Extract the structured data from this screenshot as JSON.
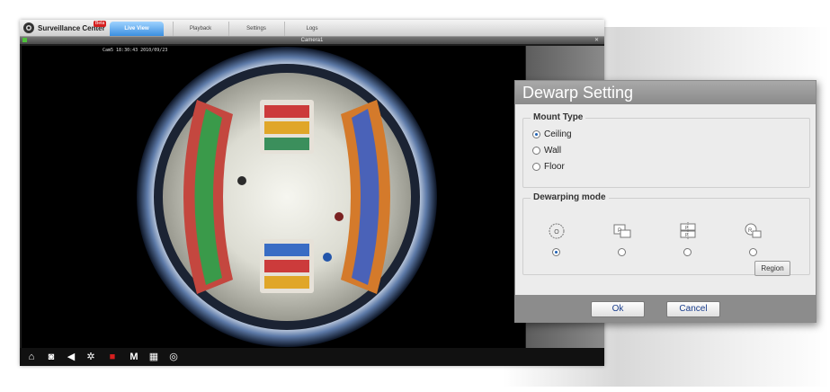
{
  "app": {
    "title": "Surveillance Center",
    "badge": "Beta",
    "tabs": [
      {
        "label": "Live View",
        "active": true
      },
      {
        "label": "Playback",
        "active": false
      },
      {
        "label": "Settings",
        "active": false
      },
      {
        "label": "Logs",
        "active": false
      }
    ]
  },
  "camera_window": {
    "title": "Camera1",
    "osd_text": "Cam5 18:30:43 2010/09/23"
  },
  "toolbar_icons": [
    "home-icon",
    "camera-icon",
    "speaker-icon",
    "settings-icon",
    "record-icon",
    "m-icon",
    "layout-icon",
    "eye-icon"
  ],
  "dialog": {
    "title": "Dewarp Setting",
    "mount_type": {
      "label": "Mount Type",
      "options": [
        "Ceiling",
        "Wall",
        "Floor"
      ],
      "selected": "Ceiling"
    },
    "dewarping_mode": {
      "label": "Dewarping mode",
      "selected_index": 0,
      "region_button": "Region"
    },
    "ok_label": "Ok",
    "cancel_label": "Cancel"
  },
  "colors": {
    "accent": "#3b8fe0",
    "dialog_title_bg": "#9a9a9a",
    "record": "#d61f1f"
  }
}
